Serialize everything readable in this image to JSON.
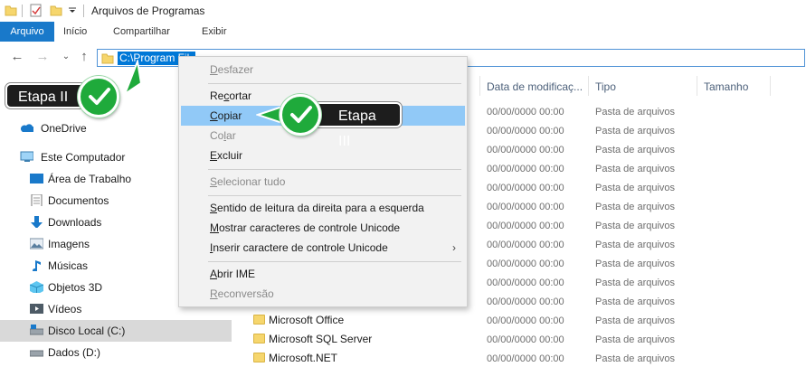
{
  "window": {
    "title": "Arquivos de Programas"
  },
  "ribbon": {
    "tabs": [
      "Arquivo",
      "Início",
      "Compartilhar",
      "Exibir"
    ]
  },
  "address": {
    "text": "C:\\Program Fil"
  },
  "sidebar": {
    "items": [
      {
        "label": "OneDrive",
        "icon": "onedrive-icon"
      },
      {
        "label": "Este Computador",
        "icon": "computer-icon"
      },
      {
        "label": "Área de Trabalho",
        "icon": "desktop-icon"
      },
      {
        "label": "Documentos",
        "icon": "documents-icon"
      },
      {
        "label": "Downloads",
        "icon": "downloads-icon"
      },
      {
        "label": "Imagens",
        "icon": "images-icon"
      },
      {
        "label": "Músicas",
        "icon": "music-icon"
      },
      {
        "label": "Objetos 3D",
        "icon": "objects-3d-icon"
      },
      {
        "label": "Vídeos",
        "icon": "videos-icon"
      },
      {
        "label": "Disco Local (C:)",
        "icon": "local-disk-icon"
      },
      {
        "label": "Dados (D:)",
        "icon": "data-drive-icon"
      }
    ]
  },
  "columns": {
    "date": "Data de modificaç...",
    "type": "Tipo",
    "size": "Tamanho"
  },
  "rows": {
    "date": "00/00/0000 00:00",
    "type": "Pasta de arquivos"
  },
  "files": [
    "Microsoft Office",
    "Microsoft SQL Server",
    "Microsoft.NET"
  ],
  "context_menu": {
    "undo": {
      "pre": "",
      "u": "D",
      "post": "esfazer"
    },
    "cut": {
      "pre": "Re",
      "u": "c",
      "post": "ortar"
    },
    "copy": {
      "pre": "",
      "u": "C",
      "post": "opiar"
    },
    "paste": {
      "pre": "Co",
      "u": "l",
      "post": "ar"
    },
    "delete": {
      "pre": "",
      "u": "E",
      "post": "xcluir"
    },
    "select_all": {
      "pre": "",
      "u": "S",
      "post": "elecionar tudo"
    },
    "rtl": {
      "pre": "",
      "u": "S",
      "post": "entido de leitura da direita para a esquerda"
    },
    "show_unicode": {
      "pre": "",
      "u": "M",
      "post": "ostrar caracteres de controle Unicode"
    },
    "insert_unicode": {
      "pre": "",
      "u": "I",
      "post": "nserir caractere de controle Unicode"
    },
    "open_ime": {
      "pre": "",
      "u": "A",
      "post": "brir IME"
    },
    "reconversion": {
      "pre": "",
      "u": "R",
      "post": "econversão"
    },
    "submenu_arrow": "›"
  },
  "callouts": {
    "step2": "Etapa II",
    "step3": "Etapa III"
  },
  "colors": {
    "accent": "#1979ca",
    "selection": "#0078d7",
    "menu_highlight": "#91c9f7",
    "check_green": "#1faa3b"
  }
}
